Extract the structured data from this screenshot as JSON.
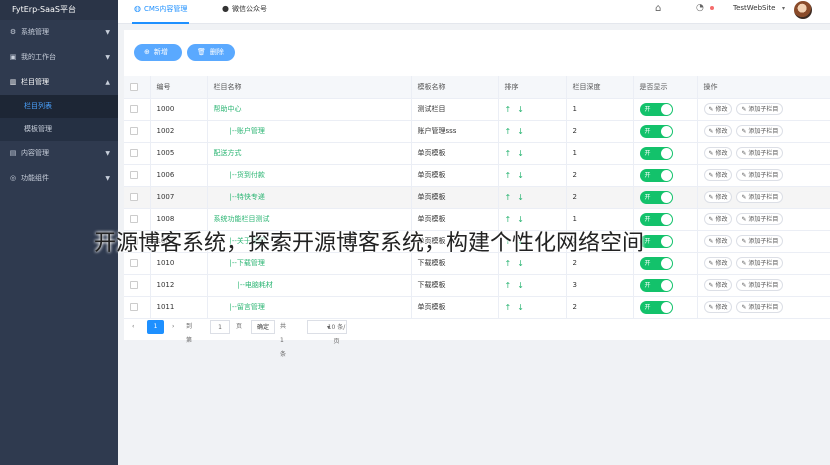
{
  "sidebar": {
    "brand": "FytErp-SaaS平台",
    "items": [
      {
        "label": "系统管理",
        "icon": "gear-icon"
      },
      {
        "label": "我的工作台",
        "icon": "desktop-icon"
      },
      {
        "label": "栏目管理",
        "icon": "columns-icon"
      },
      {
        "label": "内容管理",
        "icon": "folder-icon"
      },
      {
        "label": "功能组件",
        "icon": "component-icon"
      }
    ],
    "subitems": [
      "栏目列表",
      "模板管理"
    ]
  },
  "topbar": {
    "tabs": [
      {
        "label": "CMS内容管理",
        "icon": "globe-icon"
      },
      {
        "label": "微信公众号",
        "icon": "wechat-icon"
      }
    ],
    "user": "TestWebSite"
  },
  "toolbar": {
    "add_label": "新增",
    "delete_label": "删除"
  },
  "table": {
    "headers": [
      "编号",
      "栏目名称",
      "模板名称",
      "排序",
      "栏目深度",
      "是否显示",
      "操作"
    ],
    "rows": [
      {
        "id": "1000",
        "name": "帮助中心",
        "template": "测试栏目",
        "depth": "1"
      },
      {
        "id": "1002",
        "name": "|--账户管理",
        "template": "账户管理sss",
        "depth": "2"
      },
      {
        "id": "1005",
        "name": "配送方式",
        "template": "单页模板",
        "depth": "1"
      },
      {
        "id": "1006",
        "name": "|--货到付款",
        "template": "单页模板",
        "depth": "2"
      },
      {
        "id": "1007",
        "name": "|--特快专递",
        "template": "单页模板",
        "depth": "2"
      },
      {
        "id": "1008",
        "name": "系统功能栏目测试",
        "template": "单页模板",
        "depth": "1"
      },
      {
        "id": "1009",
        "name": "|--关于我们",
        "template": "单页模板",
        "depth": "2"
      },
      {
        "id": "1010",
        "name": "|--下载管理",
        "template": "下载模板",
        "depth": "2"
      },
      {
        "id": "1012",
        "name": "|--电脑耗材",
        "template": "下载模板",
        "depth": "3"
      },
      {
        "id": "1011",
        "name": "|--留言管理",
        "template": "单页模板",
        "depth": "2"
      }
    ],
    "switch_label": "开",
    "edit_label": "修改",
    "add_child_label": "添加子栏目"
  },
  "pager": {
    "prev": "‹",
    "current": "1",
    "next": "›",
    "goto": "到第",
    "page_input": "1",
    "unit": "页",
    "ok": "确定",
    "total": "共 1 条",
    "page_size": "10 条/页"
  },
  "watermark": "开源博客系统，探索开源博客系统，构建个性化网络空间"
}
